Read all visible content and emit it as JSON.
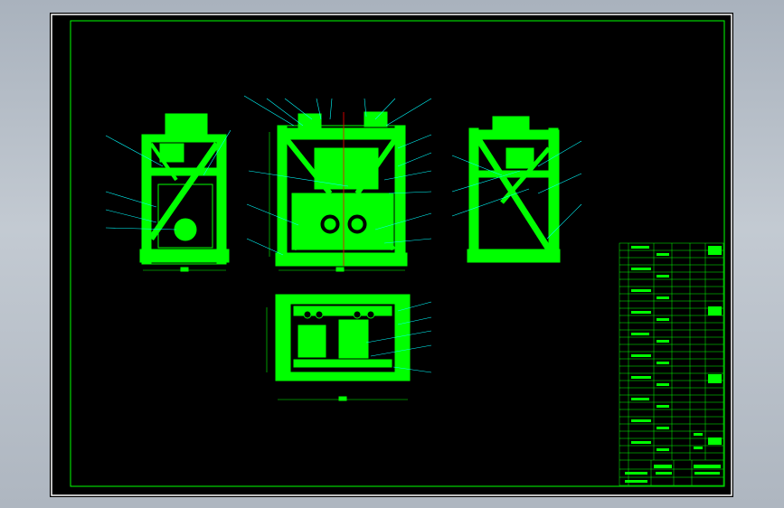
{
  "viewport": {
    "name": "cad-model-space",
    "background": "#000000",
    "frame_color": "#ffffff",
    "line_color": "#00ff00",
    "leader_color": "#00ffff",
    "accent_color": "#ff0000"
  },
  "views": [
    {
      "name": "left-side-view",
      "icon": "frame-assembly"
    },
    {
      "name": "front-view",
      "icon": "frame-assembly-with-twin-rollers"
    },
    {
      "name": "right-side-view",
      "icon": "frame-assembly"
    },
    {
      "name": "top-view",
      "icon": "frame-plan"
    }
  ],
  "title_block": {
    "rows": 31,
    "columns": 6
  }
}
